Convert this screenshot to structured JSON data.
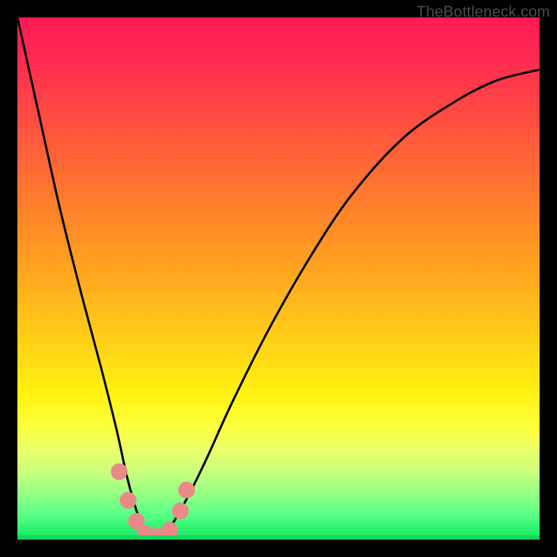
{
  "watermark": "TheBottleneck.com",
  "chart_data": {
    "type": "line",
    "title": "",
    "xlabel": "",
    "ylabel": "",
    "xlim": [
      0,
      100
    ],
    "ylim": [
      0,
      100
    ],
    "legend": false,
    "grid": false,
    "background": "rainbow-vertical-gradient",
    "series": [
      {
        "name": "bottleneck-curve",
        "color": "#000000",
        "x": [
          0,
          4,
          8,
          12,
          16,
          19,
          21,
          23,
          25,
          27,
          29,
          32,
          36,
          41,
          48,
          56,
          64,
          74,
          84,
          92,
          100
        ],
        "values": [
          100,
          82,
          64,
          48,
          33,
          21,
          12,
          5,
          1,
          0,
          2,
          7,
          15,
          26,
          40,
          54,
          66,
          77,
          84,
          88,
          90
        ]
      }
    ],
    "markers": [
      {
        "name": "marker-left-upper",
        "x": 19.5,
        "y": 13,
        "color": "#e98a88"
      },
      {
        "name": "marker-left-mid",
        "x": 21.2,
        "y": 7.5,
        "color": "#e98a88"
      },
      {
        "name": "marker-left-low",
        "x": 22.8,
        "y": 3.5,
        "color": "#e98a88"
      },
      {
        "name": "marker-bottom-l",
        "x": 24.5,
        "y": 1.2,
        "color": "#e98a88"
      },
      {
        "name": "marker-bottom-c",
        "x": 26.8,
        "y": 0.6,
        "color": "#e98a88"
      },
      {
        "name": "marker-bottom-r",
        "x": 29.2,
        "y": 1.8,
        "color": "#e98a88"
      },
      {
        "name": "marker-right-low",
        "x": 31.2,
        "y": 5.5,
        "color": "#e98a88"
      },
      {
        "name": "marker-right-upper",
        "x": 32.4,
        "y": 9.5,
        "color": "#e98a88"
      }
    ],
    "gradient_stops": [
      {
        "pos": 0,
        "color": "#ff1a55"
      },
      {
        "pos": 20,
        "color": "#ff4f3f"
      },
      {
        "pos": 48,
        "color": "#ffa320"
      },
      {
        "pos": 72,
        "color": "#fff210"
      },
      {
        "pos": 91,
        "color": "#97ff82"
      },
      {
        "pos": 100,
        "color": "#0fd95a"
      }
    ]
  }
}
